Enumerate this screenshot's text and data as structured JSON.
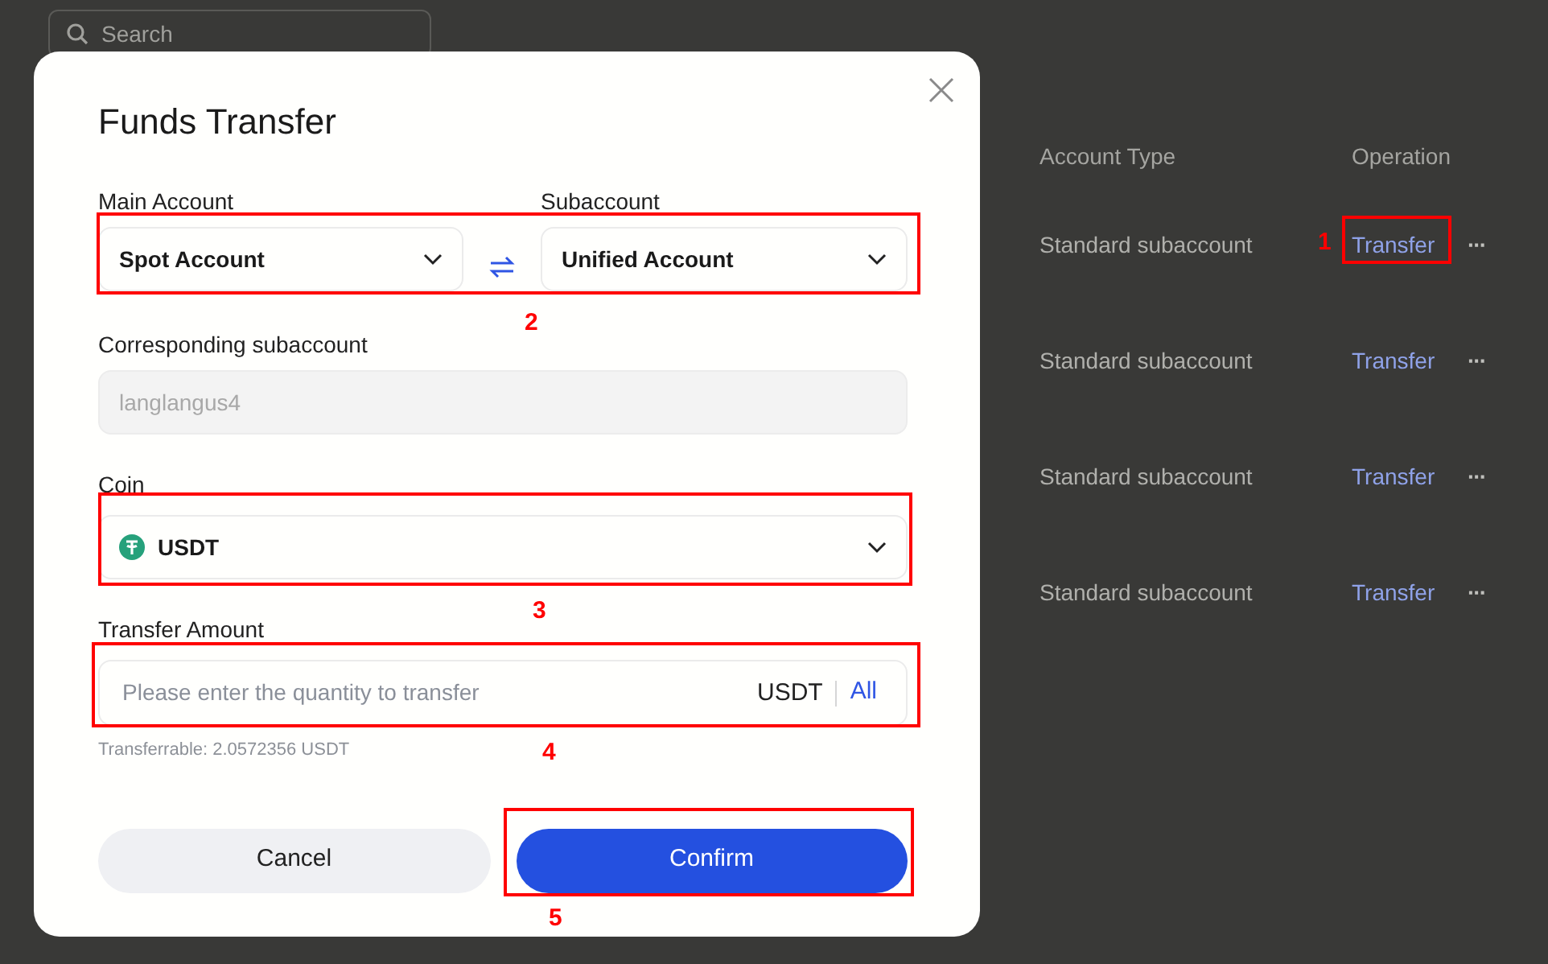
{
  "background_page": {
    "search": {
      "placeholder": "Search"
    },
    "table": {
      "columns": [
        "Account Type",
        "Operation"
      ],
      "rows": [
        {
          "account_type": "Standard subaccount",
          "operation": "Transfer",
          "more": "···"
        },
        {
          "account_type": "Standard subaccount",
          "operation": "Transfer",
          "more": "···"
        },
        {
          "account_type": "Standard subaccount",
          "operation": "Transfer",
          "more": "···"
        },
        {
          "account_type": "Standard subaccount",
          "operation": "Transfer",
          "more": "···"
        }
      ]
    }
  },
  "dialog": {
    "title": "Funds Transfer",
    "from": {
      "label": "Main Account",
      "value": "Spot Account"
    },
    "to": {
      "label": "Subaccount",
      "value": "Unified Account"
    },
    "subaccount": {
      "label": "Corresponding subaccount",
      "value": "langlangus4",
      "disabled": true
    },
    "coin": {
      "label": "Coin",
      "value": "USDT"
    },
    "amount": {
      "label": "Transfer Amount",
      "placeholder": "Please enter the quantity to transfer",
      "unit": "USDT",
      "all": "All",
      "hint": "Transferrable: 2.0572356 USDT"
    },
    "buttons": [
      {
        "label": "Cancel",
        "kind": "secondary"
      },
      {
        "label": "Confirm",
        "kind": "primary"
      }
    ]
  },
  "annotations": [
    {
      "label": "1"
    },
    {
      "label": "2"
    },
    {
      "label": "3"
    },
    {
      "label": "4"
    },
    {
      "label": "5"
    }
  ]
}
